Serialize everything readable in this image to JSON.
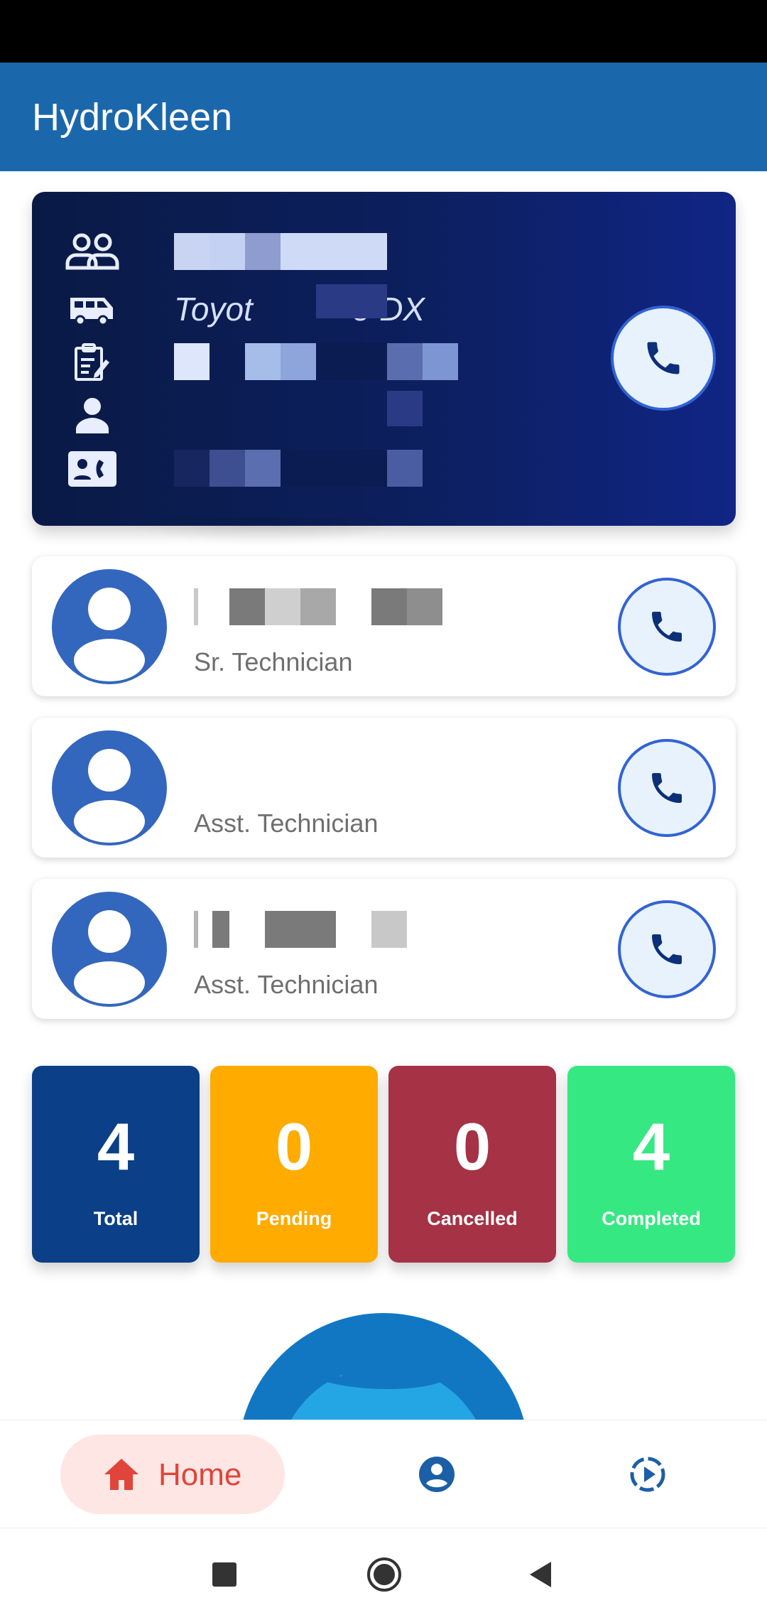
{
  "app": {
    "title": "HydroKleen"
  },
  "vehicle_card": {
    "vehicle_model_visible": "Toyot",
    "vehicle_model_suffix": "e DX"
  },
  "crew": [
    {
      "role": "Sr. Technician"
    },
    {
      "role": "Asst. Technician"
    },
    {
      "role": "Asst. Technician"
    }
  ],
  "stats": [
    {
      "value": "4",
      "label": "Total",
      "color": "#0b3f87"
    },
    {
      "value": "0",
      "label": "Pending",
      "color": "#ffab00"
    },
    {
      "value": "0",
      "label": "Cancelled",
      "color": "#a53245"
    },
    {
      "value": "4",
      "label": "Completed",
      "color": "#36e882"
    }
  ],
  "bottom_nav": {
    "home_label": "Home",
    "items": [
      "home-icon",
      "profile-icon",
      "history-icon"
    ]
  },
  "colors": {
    "app_bar": "#1b67ab",
    "accent": "#3262d4",
    "home_active": "#e0443a"
  }
}
